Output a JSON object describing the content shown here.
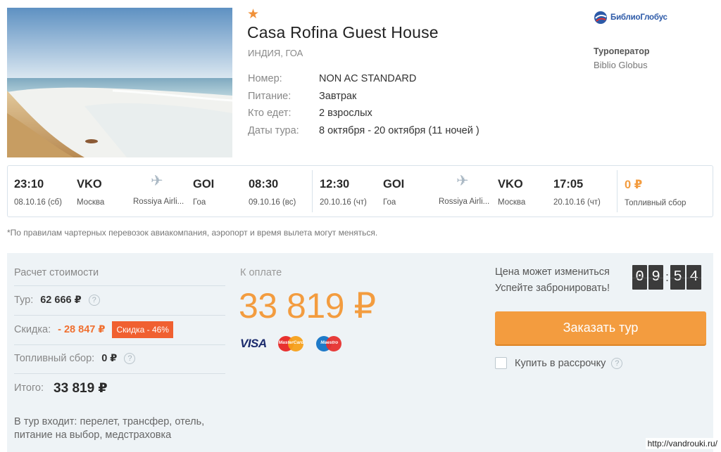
{
  "hotel": {
    "stars": "★",
    "name": "Casa Rofina Guest House",
    "location": "ИНДИЯ, ГОА",
    "details": [
      {
        "key": "Номер:",
        "value": "NON AC STANDARD"
      },
      {
        "key": "Питание:",
        "value": "Завтрак"
      },
      {
        "key": "Кто едет:",
        "value": "2 взрослых"
      },
      {
        "key": "Даты тура:",
        "value": "8 октября - 20 октября (11 ночей )"
      }
    ]
  },
  "operator": {
    "logo_text": "БиблиоГлобус",
    "label": "Туроператор",
    "name": "Biblio Globus"
  },
  "flights": {
    "outbound": {
      "dep_time": "23:10",
      "dep_date": "08.10.16 (сб)",
      "dep_code": "VKO",
      "dep_city": "Москва",
      "airline": "Rossiya Airli...",
      "arr_code": "GOI",
      "arr_city": "Гоа",
      "arr_time": "08:30",
      "arr_date": "09.10.16 (вс)"
    },
    "return": {
      "dep_time": "12:30",
      "dep_date": "20.10.16 (чт)",
      "dep_code": "GOI",
      "dep_city": "Гоа",
      "airline": "Rossiya Airli...",
      "arr_code": "VKO",
      "arr_city": "Москва",
      "arr_time": "17:05",
      "arr_date": "20.10.16 (чт)"
    },
    "fuel_price": "0 ₽",
    "fuel_label": "Топливный сбор"
  },
  "note": "*По правилам чартерных перевозок авиакомпания, аэропорт и время вылета могут меняться.",
  "calc": {
    "title": "Расчет стоимости",
    "tour_label": "Тур:",
    "tour_value": "62 666 ₽",
    "discount_label": "Скидка:",
    "discount_value": "- 28 847 ₽",
    "discount_badge": "Скидка - 46%",
    "fuel_label": "Топливный сбор:",
    "fuel_value": "0 ₽",
    "total_label": "Итого:",
    "total_value": "33 819 ₽",
    "includes": "В тур входит: перелет, трансфер, отель, питание на выбор, медстраховка",
    "help": "?"
  },
  "payment": {
    "title": "К оплате",
    "amount": "33 819 ₽",
    "cards": {
      "visa": "VISA",
      "mastercard": "MasterCard",
      "maestro": "Maestro"
    }
  },
  "booking": {
    "price_change": "Цена может измениться",
    "hurry": "Успейте забронировать!",
    "timer": [
      "0",
      "9",
      "5",
      "4"
    ],
    "button": "Заказать тур",
    "installment": "Купить в рассрочку"
  },
  "watermark": "http://vandrouki.ru/",
  "colors": {
    "accent": "#f39c3f",
    "discount": "#f06031",
    "panel": "#eef3f6"
  }
}
